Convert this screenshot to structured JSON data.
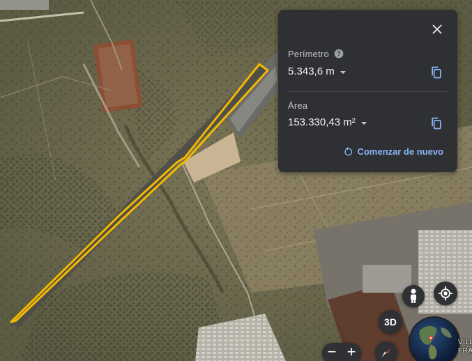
{
  "measurement_panel": {
    "perimeter_label": "Perímetro",
    "perimeter_value": "5.343,6 m",
    "area_label": "Área",
    "area_value": "153.330,43 m²",
    "restart_label": "Comenzar de nuevo"
  },
  "map_controls": {
    "three_d_label": "3D",
    "zoom_out_label": "−",
    "zoom_in_label": "+"
  },
  "map_labels": {
    "town_line1": "VILLA",
    "town_line2": "FRA"
  },
  "colors": {
    "measure_outline": "#f5b800",
    "panel_background": "#2f3033",
    "accent_link": "#8ab4f8",
    "icon_blue": "#8ab4f8"
  },
  "icons": {
    "close": "close-icon",
    "help": "help-icon",
    "caret": "caret-down-icon",
    "copy": "copy-icon",
    "restart": "restart-icon",
    "pegman": "pegman-icon",
    "my_location": "my-location-icon",
    "compass": "compass-icon",
    "globe": "globe-icon"
  }
}
